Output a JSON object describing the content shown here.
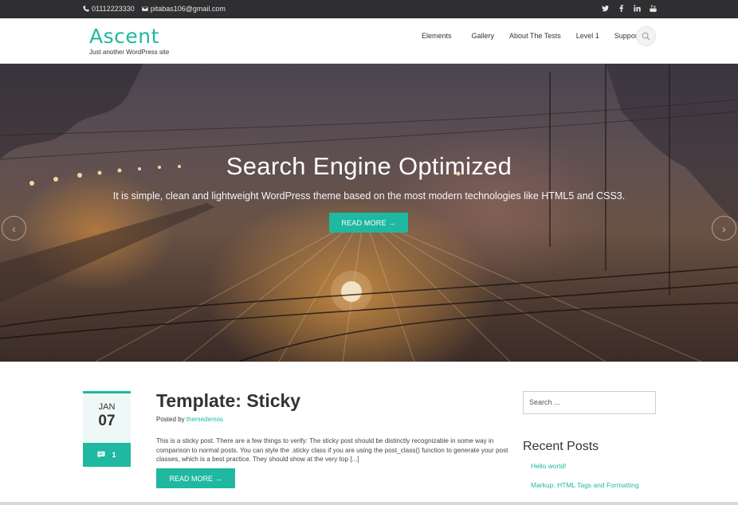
{
  "topbar": {
    "phone": "01112223330",
    "email": "pitabas106@gmail.com",
    "social_icons": [
      "twitter-icon",
      "facebook-icon",
      "linkedin-icon",
      "youtube-icon"
    ]
  },
  "header": {
    "site_title": "Ascent",
    "tagline": "Just another WordPress site",
    "nav": [
      "Elements",
      "Gallery",
      "About The Tests",
      "Level 1",
      "Support"
    ]
  },
  "hero": {
    "title": "Search Engine Optimized",
    "subtitle": "It is simple, clean and lightweight WordPress theme based on the most modern technologies like HTML5 and CSS3.",
    "button": "READ MORE →"
  },
  "post": {
    "month": "JAN",
    "day": "07",
    "comment_count": "1",
    "title": "Template: Sticky",
    "posted_by_label": "Posted by",
    "author": "themedemos",
    "excerpt": "This is a sticky post. There are a few things to verify: The sticky post should be distinctly recognizable in some way in comparison to normal posts. You can style the .sticky class if you are using the post_class() function to generate your post classes, which is a best practice. They should show at the very top [...]",
    "button": "READ MORE →"
  },
  "sidebar": {
    "search_placeholder": "Search ...",
    "recent_title": "Recent Posts",
    "recent_posts": [
      "Hello world!",
      "Markup: HTML Tags and Formatting"
    ]
  },
  "colors": {
    "accent": "#1fb8a0",
    "topbar": "#2f2f31"
  }
}
